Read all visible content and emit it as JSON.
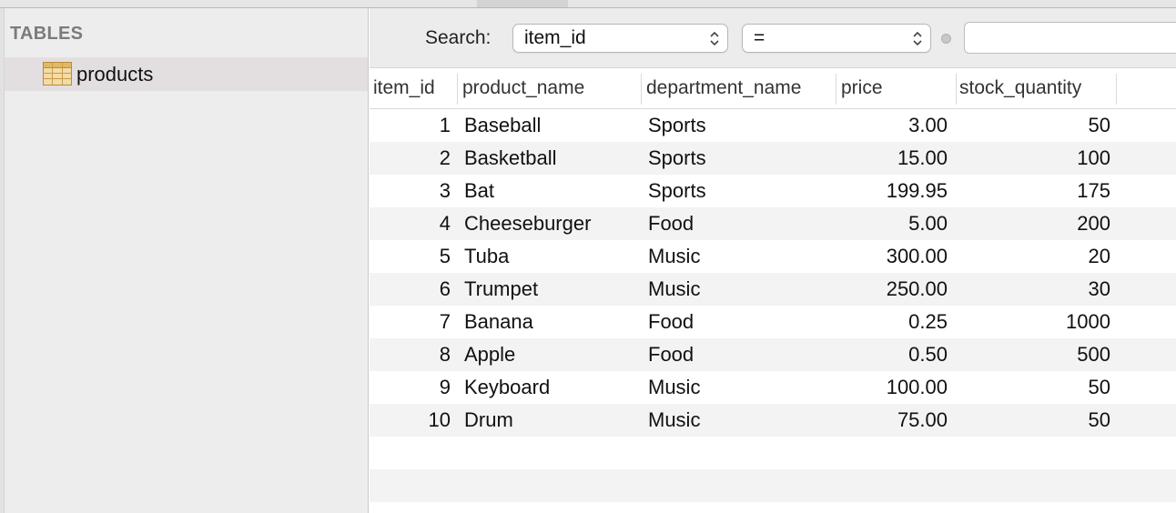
{
  "sidebar": {
    "heading": "TABLES",
    "items": [
      {
        "label": "products",
        "icon": "table-icon",
        "selected": true
      }
    ]
  },
  "search": {
    "label": "Search:",
    "field_value": "item_id",
    "operator_value": "=",
    "input_value": "",
    "input_placeholder": ""
  },
  "table": {
    "columns": [
      "item_id",
      "product_name",
      "department_name",
      "price",
      "stock_quantity"
    ],
    "rows": [
      [
        "1",
        "Baseball",
        "Sports",
        "3.00",
        "50"
      ],
      [
        "2",
        "Basketball",
        "Sports",
        "15.00",
        "100"
      ],
      [
        "3",
        "Bat",
        "Sports",
        "199.95",
        "175"
      ],
      [
        "4",
        "Cheeseburger",
        "Food",
        "5.00",
        "200"
      ],
      [
        "5",
        "Tuba",
        "Music",
        "300.00",
        "20"
      ],
      [
        "6",
        "Trumpet",
        "Music",
        "250.00",
        "30"
      ],
      [
        "7",
        "Banana",
        "Food",
        "0.25",
        "1000"
      ],
      [
        "8",
        "Apple",
        "Food",
        "0.50",
        "500"
      ],
      [
        "9",
        "Keyboard",
        "Music",
        "100.00",
        "50"
      ],
      [
        "10",
        "Drum",
        "Music",
        "75.00",
        "50"
      ]
    ]
  },
  "colors": {
    "sidebar_bg": "#ededed",
    "selected_row": "#e3dfe0",
    "stripe": "#f3f3f3",
    "table_icon": "#e7c78a"
  }
}
